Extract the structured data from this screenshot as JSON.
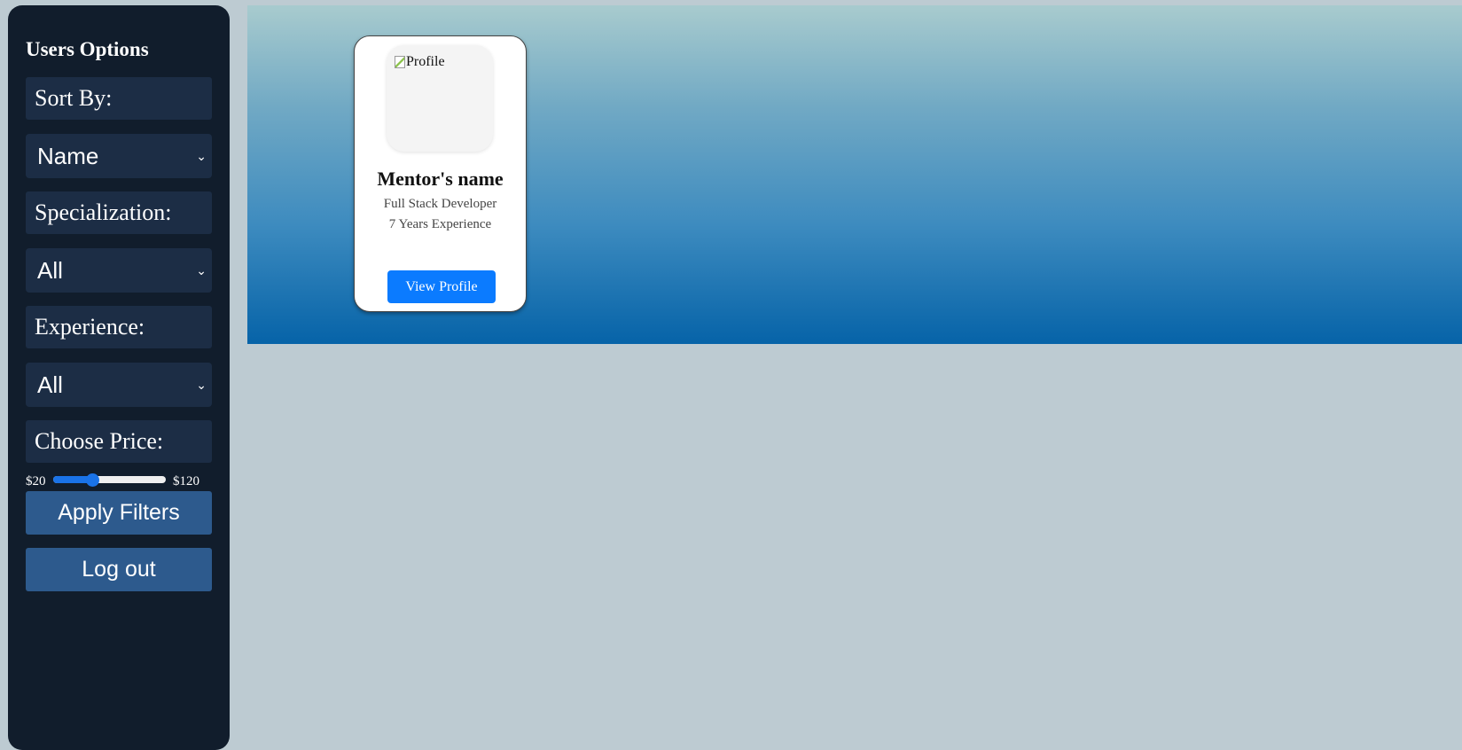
{
  "sidebar": {
    "title": "Users Options",
    "sort_label": "Sort By:",
    "sort_value": "Name",
    "specialization_label": "Specialization:",
    "specialization_value": "All",
    "experience_label": "Experience:",
    "experience_value": "All",
    "price_label": "Choose Price:",
    "price_min_label": "$20",
    "price_max_label": "$120",
    "price_slider_fraction": 0.35,
    "apply_label": "Apply Filters",
    "logout_label": "Log out"
  },
  "mentor_card": {
    "image_alt": "Profile",
    "name": "Mentor's name",
    "role": "Full Stack Developer",
    "experience": "7 Years Experience",
    "button_label": "View Profile"
  },
  "colors": {
    "sidebar_bg": "#111d2c",
    "control_bg": "#1c2d45",
    "button_bg": "#2d5a8d",
    "accent": "#0b7bff",
    "page_bg": "#bdcbd2"
  },
  "icons": {
    "select_chevron": "chevron-down-icon",
    "broken_image": "broken-image-icon"
  }
}
